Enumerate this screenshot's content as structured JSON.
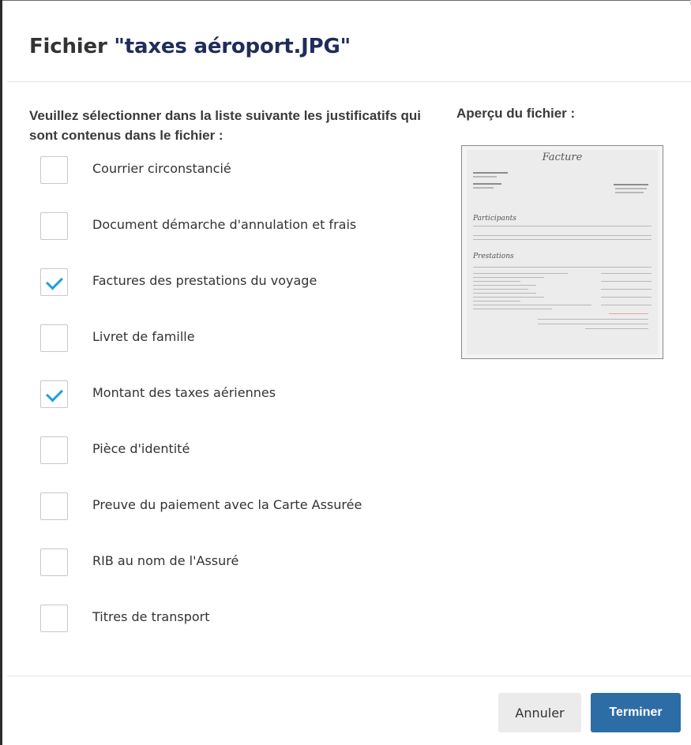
{
  "dialog": {
    "title_prefix": "Fichier ",
    "title_filename": "\"taxes aéroport.JPG\"",
    "instructions": "Veuillez sélectionner dans la liste suivante les justificatifs qui sont contenus dans le fichier :",
    "preview_label": "Aperçu du fichier :"
  },
  "items": [
    {
      "label": "Courrier circonstancié",
      "checked": false
    },
    {
      "label": "Document démarche d'annulation et frais",
      "checked": false
    },
    {
      "label": "Factures des prestations du voyage",
      "checked": true
    },
    {
      "label": "Livret de famille",
      "checked": false
    },
    {
      "label": "Montant des taxes aériennes",
      "checked": true
    },
    {
      "label": "Pièce d'identité",
      "checked": false
    },
    {
      "label": "Preuve du paiement avec la Carte Assurée",
      "checked": false
    },
    {
      "label": "RIB au nom de l'Assuré",
      "checked": false
    },
    {
      "label": "Titres de transport",
      "checked": false
    }
  ],
  "preview_doc": {
    "title": "Facture",
    "section1": "Participants",
    "section2": "Prestations"
  },
  "footer": {
    "cancel_label": "Annuler",
    "finish_label": "Terminer"
  },
  "colors": {
    "accent": "#2d6da6",
    "check": "#1e9fd8",
    "title_filename": "#1f2d5a"
  }
}
